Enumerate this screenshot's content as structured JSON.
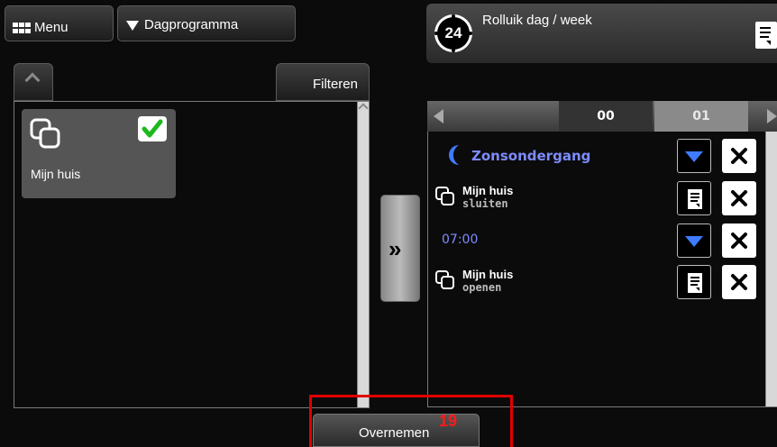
{
  "topbar": {
    "menu_label": "Menu",
    "program_label": "Dagprogramma"
  },
  "header": {
    "clock_number": "24",
    "title": "Rolluik dag / week"
  },
  "left_panel": {
    "filter_label": "Filteren",
    "tile": {
      "label": "Mijn huis",
      "selected": true
    }
  },
  "transfer_button": {
    "label": "»"
  },
  "hours": {
    "current": "00",
    "next": "01"
  },
  "schedule": [
    {
      "type": "event",
      "label": "Zonsondergang",
      "action_icon": "triangle-down-icon"
    },
    {
      "type": "command",
      "name": "Mijn huis",
      "command": "sluiten",
      "action_icon": "document-icon"
    },
    {
      "type": "time",
      "label": "07:00",
      "action_icon": "triangle-down-icon"
    },
    {
      "type": "command",
      "name": "Mijn huis",
      "command": "openen",
      "action_icon": "document-icon"
    }
  ],
  "footer": {
    "accept_label": "Overnemen",
    "step_number": "19"
  },
  "colors": {
    "accent_blue": "#3f7bff",
    "highlight_red": "#e00000",
    "check_green": "#1cb81c"
  }
}
